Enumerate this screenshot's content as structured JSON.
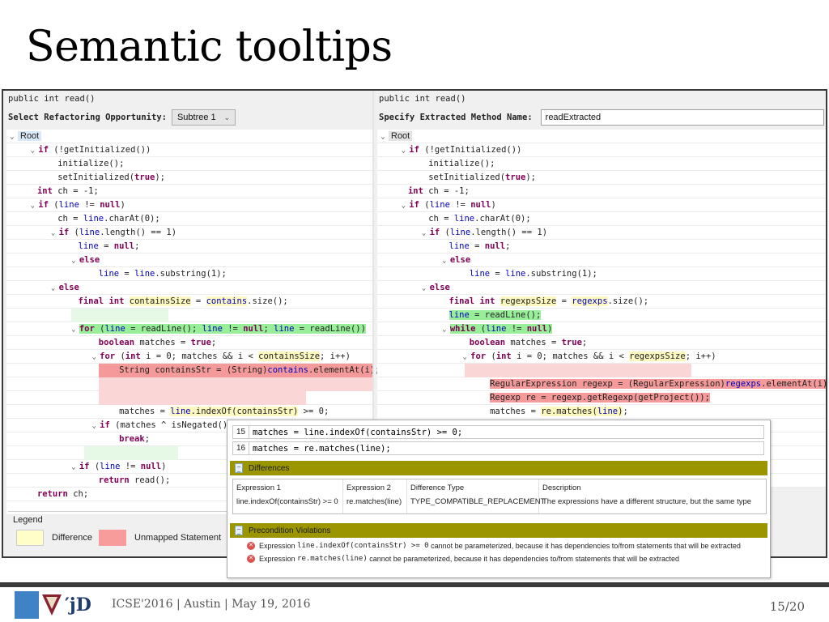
{
  "slide": {
    "title": "Semantic tooltips",
    "footer": "ICSE'2016 | Austin | May 19, 2016",
    "page": "15/20"
  },
  "left_pane": {
    "signature": "public int read()",
    "select_label": "Select Refactoring Opportunity:",
    "select_value": "Subtree 1",
    "root_label": "Root"
  },
  "right_pane": {
    "signature": "public int read()",
    "name_label": "Specify Extracted Method Name:",
    "name_value": "readExtracted",
    "root_label": "Root"
  },
  "legend": {
    "title": "Legend",
    "difference_label": "Difference",
    "unmapped_label": "Unmapped Statement",
    "colors": {
      "difference": "#fffdc8",
      "unmapped": "#f79b9b",
      "mapped_moved": "#99ee99"
    }
  },
  "tooltip": {
    "line1_num": "15",
    "line1_code": "matches = line.indexOf(containsStr) >= 0;",
    "line2_num": "16",
    "line2_code": "matches = re.matches(line);",
    "differences_title": "Differences",
    "columns": [
      "Expression 1",
      "Expression 2",
      "Difference Type",
      "Description"
    ],
    "row": [
      "line.indexOf(containsStr) >= 0",
      "re.matches(line)",
      "TYPE_COMPATIBLE_REPLACEMENT",
      "The expressions have a different structure, but the same type"
    ],
    "violations_title": "Precondition Violations",
    "violations": [
      {
        "prefix": "Expression",
        "expr": "line.indexOf(containsStr) >= 0",
        "suffix": "cannot be parameterized, because it has dependencies to/from statements that will be extracted"
      },
      {
        "prefix": "Expression",
        "expr": "re.matches(line)",
        "suffix": "cannot be parameterized, because it has dependencies to/from statements that will be extracted"
      }
    ],
    "bar_color": "#9b9600"
  }
}
